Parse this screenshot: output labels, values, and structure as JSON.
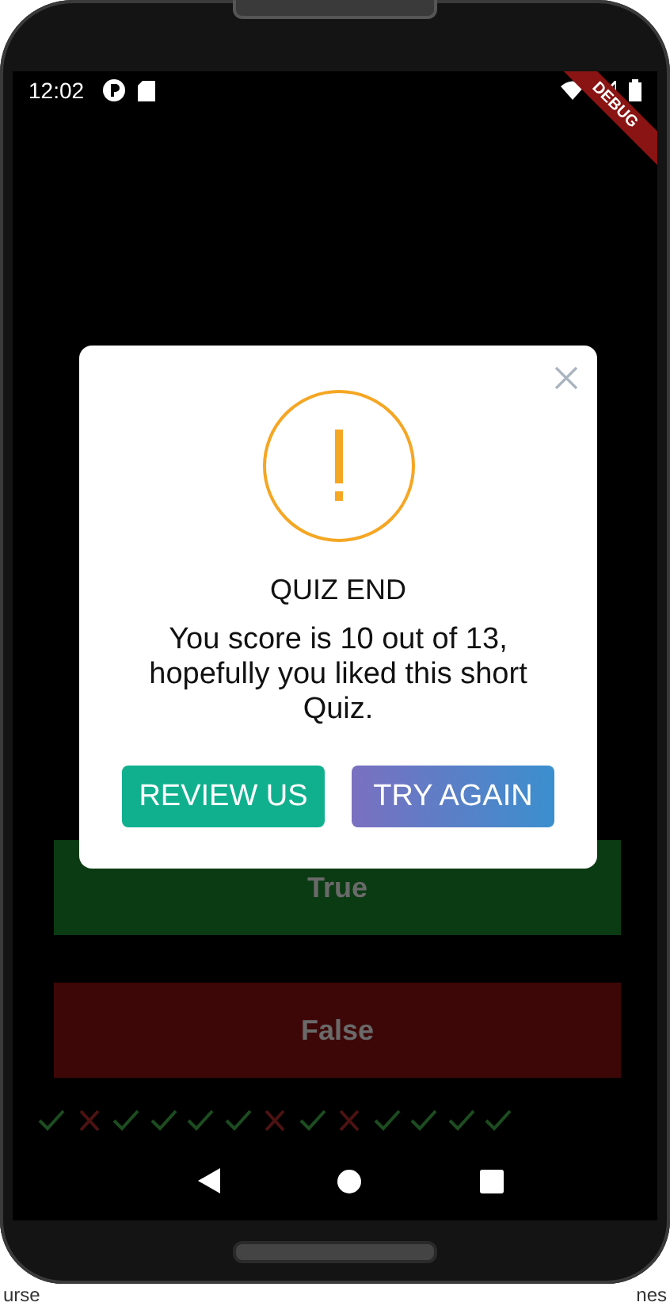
{
  "status_bar": {
    "time": "12:02"
  },
  "debug_banner": "DEBUG",
  "answer_buttons": [
    {
      "label": "True",
      "kind": "true"
    },
    {
      "label": "False",
      "kind": "false"
    }
  ],
  "score_marks": [
    {
      "correct": true
    },
    {
      "correct": false
    },
    {
      "correct": true
    },
    {
      "correct": true
    },
    {
      "correct": true
    },
    {
      "correct": true
    },
    {
      "correct": false
    },
    {
      "correct": true
    },
    {
      "correct": false
    },
    {
      "correct": true
    },
    {
      "correct": true
    },
    {
      "correct": true
    },
    {
      "correct": true
    }
  ],
  "dialog": {
    "title": "QUIZ END",
    "message": "You score is 10 out of 13, hopefully you liked this short Quiz.",
    "buttons": [
      {
        "label": "REVIEW US",
        "kind": "review"
      },
      {
        "label": "TRY AGAIN",
        "kind": "retry"
      }
    ]
  },
  "background_texts": [
    "urse",
    "nes"
  ]
}
